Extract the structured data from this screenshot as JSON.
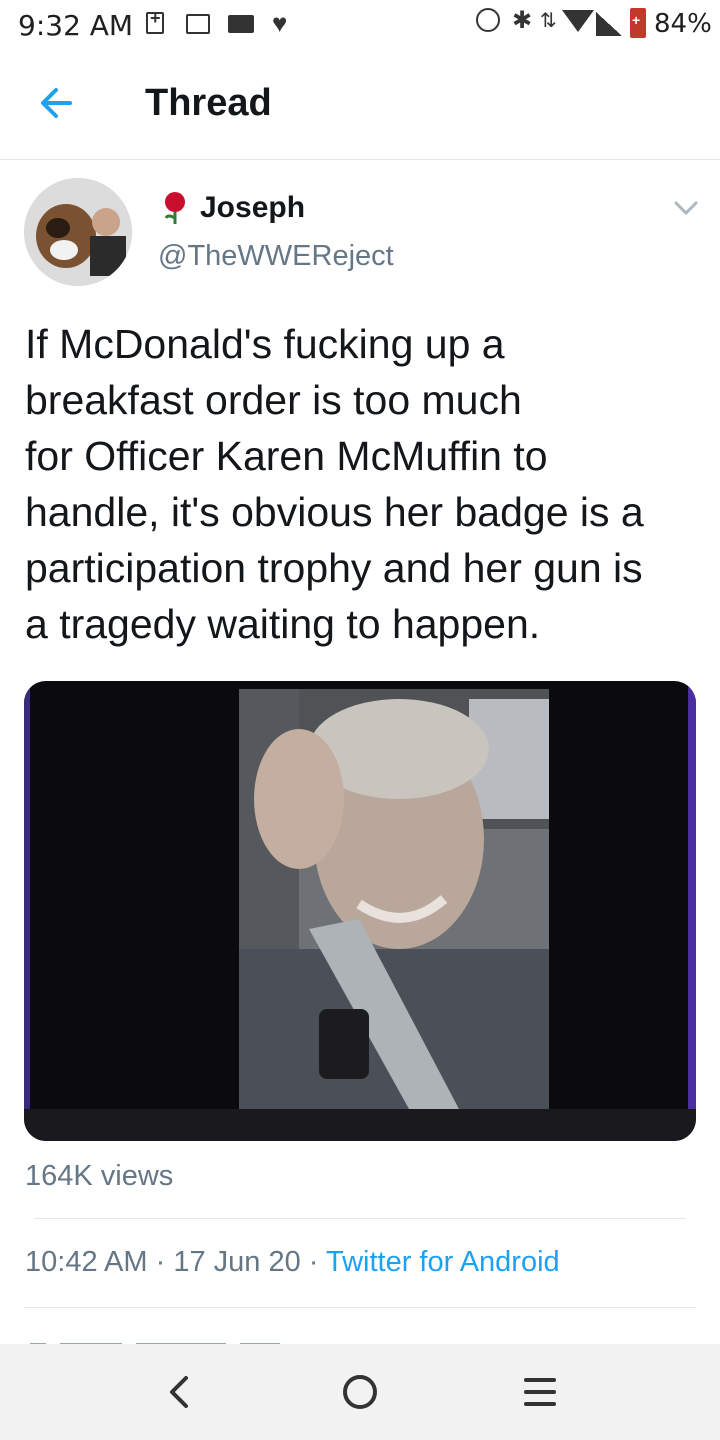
{
  "status_bar": {
    "time": "9:32 AM",
    "battery": "84%",
    "icons": [
      "plus-box-icon",
      "image-icon",
      "mail-icon",
      "heart-icon",
      "alarm-icon",
      "bluetooth-icon",
      "data-arrows-icon",
      "wifi-icon",
      "signal-icon",
      "battery-icon"
    ]
  },
  "header": {
    "back_icon": "arrow-left-icon",
    "title": "Thread",
    "accent_color": "#1da1f2"
  },
  "tweet": {
    "author_name": "Joseph",
    "author_handle": "@TheWWEReject",
    "name_emoji_icon": "rose-icon",
    "menu_icon": "chevron-down-icon",
    "text": "If McDonald's fucking up a\nbreakfast order is too much\nfor Officer Karen McMuffin to\nhandle, it's obvious her badge is a\nparticipation trophy and her gun is\na tragedy waiting to happen.",
    "views": "164K views",
    "time": "10:42 AM",
    "separator": " · ",
    "date": "17 Jun 20",
    "source": "Twitter for Android"
  },
  "nav_bar": {
    "icons": [
      "back-chevron-icon",
      "home-circle-icon",
      "menu-lines-icon"
    ]
  }
}
